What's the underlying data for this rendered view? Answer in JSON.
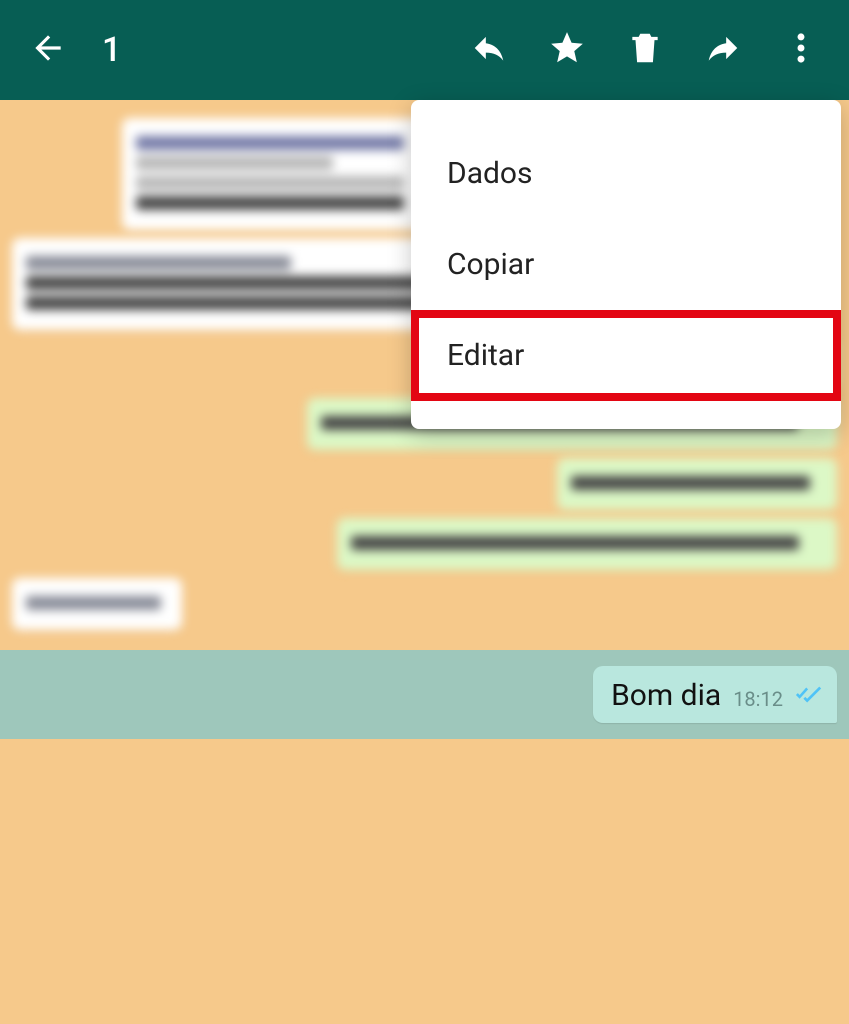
{
  "topbar": {
    "selected_count": "1"
  },
  "menu": {
    "items": [
      {
        "label": "Dados"
      },
      {
        "label": "Copiar"
      },
      {
        "label": "Editar",
        "highlighted": true
      }
    ]
  },
  "selected_message": {
    "text": "Bom dia",
    "time": "18:12"
  }
}
